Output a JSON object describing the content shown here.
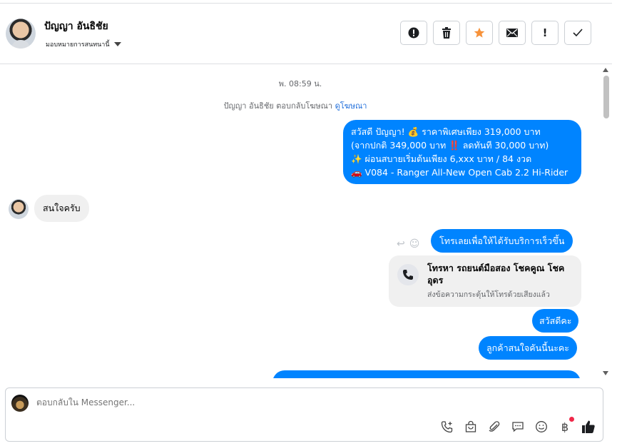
{
  "header": {
    "contact_name": "ปัญญา อันธิชัย",
    "assign_label": "มอบหมายการสนทนานี้",
    "actions": [
      {
        "name": "mark-spam-button",
        "icon": "alert-circle-icon",
        "glyph": "❗"
      },
      {
        "name": "delete-button",
        "icon": "trash-icon",
        "glyph": "🗑"
      },
      {
        "name": "star-button",
        "icon": "star-icon",
        "glyph": "★"
      },
      {
        "name": "mark-unread-button",
        "icon": "envelope-icon",
        "glyph": "✉"
      },
      {
        "name": "follow-up-button",
        "icon": "exclamation-icon",
        "glyph": "!"
      },
      {
        "name": "mark-done-button",
        "icon": "check-icon",
        "glyph": "✓"
      }
    ]
  },
  "messages": {
    "timestamp": "พ. 08:59 น.",
    "ad_reply_text": "ปัญญา อันธิชัย ตอบกลับโฆษณา",
    "ad_link": "ดูโฆษณา",
    "promo_lines": [
      "สวัสดี ปัญญา! 💰 ราคาพิเศษเพียง 319,000 บาท",
      "(จากปกติ 349,000 บาท ‼️ ลดทันที 30,000 บาท)",
      "✨ ผ่อนสบายเริ่มต้นเพียง 6,xxx บาท / 84 งวด",
      "🚗 V084 - Ranger All-New Open Cab 2.2 Hi-Rider"
    ],
    "incoming_1": "สนใจครับ",
    "outgoing_call_prompt": "โทรเลยเพื่อให้ได้รับบริการเร็วขึ้น",
    "call_card_title": "โทรหา รถยนต์มือสอง โชคคูณ โชค อุดร",
    "call_card_sub": "ส่งข้อความกระตุ้นให้โทรด้วยเสียงแล้ว",
    "outgoing_hello": "สวัสดีคะ",
    "outgoing_interest": "ลูกค้าสนใจคันนี้นะคะ"
  },
  "composer": {
    "placeholder": "ตอบกลับใน Messenger...",
    "tools": [
      "call-add-icon",
      "shopping-bag-icon",
      "paperclip-icon",
      "saved-reply-icon",
      "emoji-icon",
      "baht-icon",
      "like-icon"
    ]
  },
  "colors": {
    "accent": "#0084ff",
    "incoming_bubble": "#f0f0f0",
    "notification_dot": "#f02849"
  }
}
